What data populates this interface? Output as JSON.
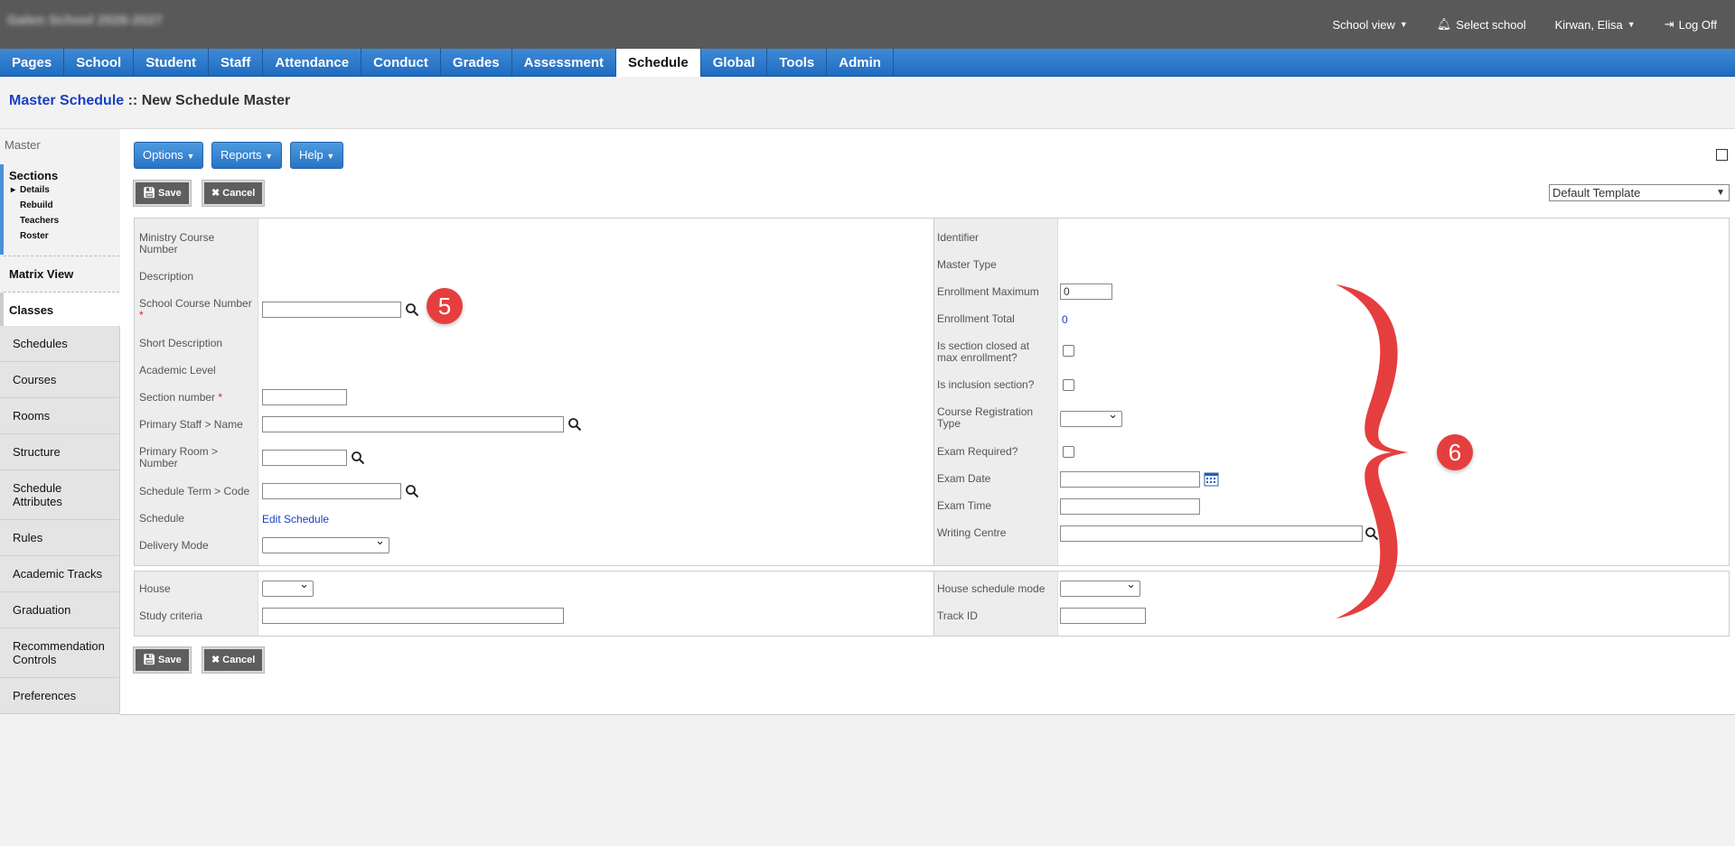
{
  "header": {
    "school_name": "Galen School 2026-2027",
    "school_view": "School view",
    "select_school": "Select school",
    "user": "Kirwan, Elisa",
    "log_off": "Log Off"
  },
  "nav": [
    "Pages",
    "School",
    "Student",
    "Staff",
    "Attendance",
    "Conduct",
    "Grades",
    "Assessment",
    "Schedule",
    "Global",
    "Tools",
    "Admin"
  ],
  "breadcrumb": {
    "link": "Master Schedule",
    "sep": " :: ",
    "current": "New Schedule Master"
  },
  "sidebar": {
    "master_label": "Master",
    "sections_title": "Sections",
    "sections_items": [
      "Details",
      "Rebuild",
      "Teachers",
      "Roster"
    ],
    "matrix_view": "Matrix View",
    "classes": "Classes",
    "items": [
      "Schedules",
      "Courses",
      "Rooms",
      "Structure",
      "Schedule Attributes",
      "Rules",
      "Academic Tracks",
      "Graduation",
      "Recommendation Controls",
      "Preferences"
    ]
  },
  "toolbar": {
    "options": "Options",
    "reports": "Reports",
    "help": "Help",
    "save": "Save",
    "cancel": "Cancel",
    "template": "Default Template"
  },
  "form": {
    "ministry_course_number": "Ministry Course Number",
    "description": "Description",
    "school_course_number": "School Course Number",
    "short_description": "Short Description",
    "academic_level": "Academic Level",
    "section_number": "Section number",
    "primary_staff": "Primary Staff > Name",
    "primary_room": "Primary Room > Number",
    "schedule_term": "Schedule Term > Code",
    "schedule": "Schedule",
    "edit_schedule": "Edit Schedule",
    "delivery_mode": "Delivery Mode",
    "identifier": "Identifier",
    "master_type": "Master Type",
    "enrollment_maximum": "Enrollment Maximum",
    "enrollment_maximum_value": "0",
    "enrollment_total": "Enrollment Total",
    "enrollment_total_value": "0",
    "is_section_closed": "Is section closed at max enrollment?",
    "is_inclusion": "Is inclusion section?",
    "course_registration_type": "Course Registration Type",
    "exam_required": "Exam Required?",
    "exam_date": "Exam Date",
    "exam_time": "Exam Time",
    "writing_centre": "Writing Centre",
    "house": "House",
    "study_criteria": "Study criteria",
    "house_schedule_mode": "House schedule mode",
    "track_id": "Track ID"
  },
  "annotations": {
    "badge5": "5",
    "badge6": "6",
    "color": "#e53e3e"
  },
  "colors": {
    "nav_blue": "#2a73c5",
    "link_blue": "#1b3ec4",
    "header_gray": "#595959"
  }
}
